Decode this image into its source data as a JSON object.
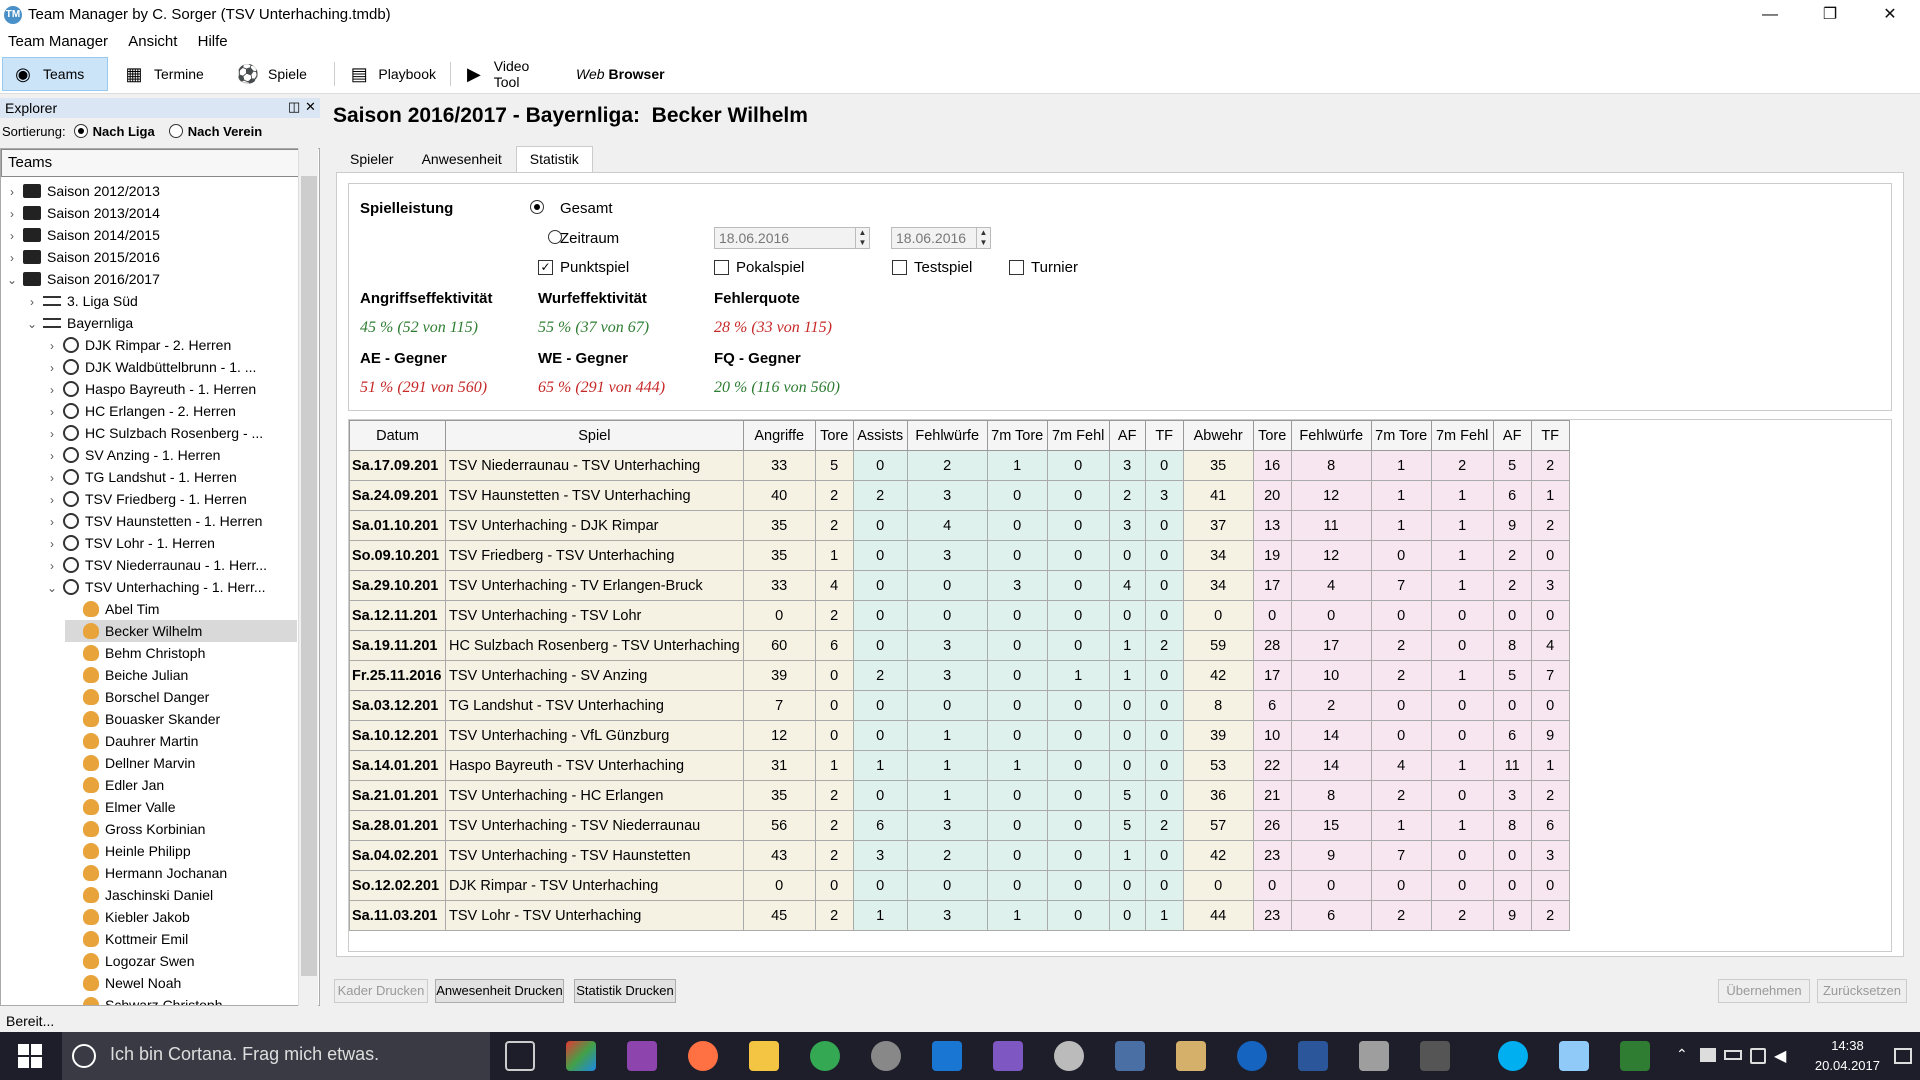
{
  "window": {
    "title": "Team Manager by C. Sorger (TSV Unterhaching.tmdb)"
  },
  "menu": [
    "Team Manager",
    "Ansicht",
    "Hilfe"
  ],
  "toolbar": {
    "teams": "Teams",
    "termine": "Termine",
    "spiele": "Spiele",
    "playbook": "Playbook",
    "video": "Video Tool",
    "web_prefix": "Web",
    "web": "Browser"
  },
  "explorer": {
    "title": "Explorer",
    "sort_label": "Sortierung:",
    "sort_liga": "Nach Liga",
    "sort_verein": "Nach Verein",
    "tree_header": "Teams",
    "items": [
      {
        "label": "Saison 2012/2013",
        "level": 0,
        "icon": "folder-icon",
        "chev": "›"
      },
      {
        "label": "Saison 2013/2014",
        "level": 0,
        "icon": "folder-icon",
        "chev": "›"
      },
      {
        "label": "Saison 2014/2015",
        "level": 0,
        "icon": "folder-icon",
        "chev": "›"
      },
      {
        "label": "Saison 2015/2016",
        "level": 0,
        "icon": "folder-icon",
        "chev": "›"
      },
      {
        "label": "Saison 2016/2017",
        "level": 0,
        "icon": "folder-icon",
        "chev": "⌄"
      },
      {
        "label": "3. Liga Süd",
        "level": 1,
        "icon": "list-icon",
        "chev": "›"
      },
      {
        "label": "Bayernliga",
        "level": 1,
        "icon": "list-icon",
        "chev": "⌄"
      },
      {
        "label": "DJK Rimpar - 2. Herren",
        "level": 2,
        "icon": "team-icon",
        "chev": "›"
      },
      {
        "label": "DJK Waldbüttelbrunn - 1. ...",
        "level": 2,
        "icon": "team-icon",
        "chev": "›"
      },
      {
        "label": "Haspo Bayreuth - 1. Herren",
        "level": 2,
        "icon": "team-icon",
        "chev": "›"
      },
      {
        "label": "HC Erlangen - 2. Herren",
        "level": 2,
        "icon": "team-icon",
        "chev": "›"
      },
      {
        "label": "HC Sulzbach Rosenberg - ...",
        "level": 2,
        "icon": "team-icon",
        "chev": "›"
      },
      {
        "label": "SV Anzing - 1. Herren",
        "level": 2,
        "icon": "team-icon",
        "chev": "›"
      },
      {
        "label": "TG Landshut - 1. Herren",
        "level": 2,
        "icon": "team-icon",
        "chev": "›"
      },
      {
        "label": "TSV Friedberg - 1. Herren",
        "level": 2,
        "icon": "team-icon",
        "chev": "›"
      },
      {
        "label": "TSV Haunstetten - 1. Herren",
        "level": 2,
        "icon": "team-icon",
        "chev": "›"
      },
      {
        "label": "TSV Lohr - 1. Herren",
        "level": 2,
        "icon": "team-icon",
        "chev": "›"
      },
      {
        "label": "TSV Niederraunau - 1. Herr...",
        "level": 2,
        "icon": "team-icon",
        "chev": "›"
      },
      {
        "label": "TSV Unterhaching - 1. Herr...",
        "level": 2,
        "icon": "team-icon",
        "chev": "⌄"
      },
      {
        "label": "Abel Tim",
        "level": 3,
        "icon": "player-icon",
        "chev": ""
      },
      {
        "label": "Becker Wilhelm",
        "level": 3,
        "icon": "player-icon",
        "chev": "",
        "selected": true
      },
      {
        "label": "Behm Christoph",
        "level": 3,
        "icon": "player-icon",
        "chev": ""
      },
      {
        "label": "Beiche Julian",
        "level": 3,
        "icon": "player-icon",
        "chev": ""
      },
      {
        "label": "Borschel Danger",
        "level": 3,
        "icon": "player-icon",
        "chev": ""
      },
      {
        "label": "Bouasker Skander",
        "level": 3,
        "icon": "player-icon",
        "chev": ""
      },
      {
        "label": "Dauhrer Martin",
        "level": 3,
        "icon": "player-icon",
        "chev": ""
      },
      {
        "label": "Dellner Marvin",
        "level": 3,
        "icon": "player-icon",
        "chev": ""
      },
      {
        "label": "Edler Jan",
        "level": 3,
        "icon": "player-icon",
        "chev": ""
      },
      {
        "label": "Elmer Valle",
        "level": 3,
        "icon": "player-icon",
        "chev": ""
      },
      {
        "label": "Gross Korbinian",
        "level": 3,
        "icon": "player-icon",
        "chev": ""
      },
      {
        "label": "Heinle Philipp",
        "level": 3,
        "icon": "player-icon",
        "chev": ""
      },
      {
        "label": "Hermann Jochanan",
        "level": 3,
        "icon": "player-icon",
        "chev": ""
      },
      {
        "label": "Jaschinski Daniel",
        "level": 3,
        "icon": "player-icon",
        "chev": ""
      },
      {
        "label": "Kiebler Jakob",
        "level": 3,
        "icon": "player-icon",
        "chev": ""
      },
      {
        "label": "Kottmeir Emil",
        "level": 3,
        "icon": "player-icon",
        "chev": ""
      },
      {
        "label": "Logozar Swen",
        "level": 3,
        "icon": "player-icon",
        "chev": ""
      },
      {
        "label": "Newel Noah",
        "level": 3,
        "icon": "player-icon",
        "chev": ""
      },
      {
        "label": "Schwarz Christoph",
        "level": 3,
        "icon": "player-icon",
        "chev": ""
      }
    ]
  },
  "page": {
    "season": "Saison 2016/2017 - Bayernliga:",
    "player": "Becker Wilhelm"
  },
  "tabs": [
    "Spieler",
    "Anwesenheit",
    "Statistik"
  ],
  "filter": {
    "section": "Spielleistung",
    "gesamt": "Gesamt",
    "zeitraum": "Zeitraum",
    "date_from": "18.06.2016",
    "date_to": "18.06.2016",
    "punktspiel": "Punktspiel",
    "pokalspiel": "Pokalspiel",
    "testspiel": "Testspiel",
    "turnier": "Turnier"
  },
  "summary": {
    "ae_label": "Angriffseffektivität",
    "ae_value": "45 %  (52 von 115)",
    "we_label": "Wurfeffektivität",
    "we_value": "55 %  (37 von 67)",
    "fq_label": "Fehlerquote",
    "fq_value": "28 %  (33 von 115)",
    "aeg_label": "AE - Gegner",
    "aeg_value": "51 %  (291 von 560)",
    "weg_label": "WE - Gegner",
    "weg_value": "65 %  (291 von 444)",
    "fqg_label": "FQ - Gegner",
    "fqg_value": "20 %  (116 von 560)"
  },
  "table": {
    "headers": [
      "Datum",
      "Spiel",
      "Angriffe",
      "Tore",
      "Assists",
      "Fehlwürfe",
      "7m Tore",
      "7m Fehl",
      "AF",
      "TF",
      "Abwehr",
      "Tore",
      "Fehlwürfe",
      "7m Tore",
      "7m Fehl",
      "AF",
      "TF"
    ],
    "rows": [
      [
        "Sa.17.09.201",
        "TSV Niederraunau  -  TSV Unterhaching",
        "33",
        "5",
        "0",
        "2",
        "1",
        "0",
        "3",
        "0",
        "35",
        "16",
        "8",
        "1",
        "2",
        "5",
        "2"
      ],
      [
        "Sa.24.09.201",
        "TSV Haunstetten  -  TSV Unterhaching",
        "40",
        "2",
        "2",
        "3",
        "0",
        "0",
        "2",
        "3",
        "41",
        "20",
        "12",
        "1",
        "1",
        "6",
        "1"
      ],
      [
        "Sa.01.10.201",
        "TSV Unterhaching  -  DJK Rimpar",
        "35",
        "2",
        "0",
        "4",
        "0",
        "0",
        "3",
        "0",
        "37",
        "13",
        "11",
        "1",
        "1",
        "9",
        "2"
      ],
      [
        "So.09.10.201",
        "TSV Friedberg  -  TSV Unterhaching",
        "35",
        "1",
        "0",
        "3",
        "0",
        "0",
        "0",
        "0",
        "34",
        "19",
        "12",
        "0",
        "1",
        "2",
        "0"
      ],
      [
        "Sa.29.10.201",
        "TSV Unterhaching  -  TV Erlangen-Bruck",
        "33",
        "4",
        "0",
        "0",
        "3",
        "0",
        "4",
        "0",
        "34",
        "17",
        "4",
        "7",
        "1",
        "2",
        "3"
      ],
      [
        "Sa.12.11.201",
        "TSV Unterhaching  -  TSV Lohr",
        "0",
        "2",
        "0",
        "0",
        "0",
        "0",
        "0",
        "0",
        "0",
        "0",
        "0",
        "0",
        "0",
        "0",
        "0"
      ],
      [
        "Sa.19.11.201",
        "HC Sulzbach Rosenberg  -  TSV Unterhaching",
        "60",
        "6",
        "0",
        "3",
        "0",
        "0",
        "1",
        "2",
        "59",
        "28",
        "17",
        "2",
        "0",
        "8",
        "4"
      ],
      [
        "Fr.25.11.2016",
        "TSV Unterhaching  -  SV Anzing",
        "39",
        "0",
        "2",
        "3",
        "0",
        "1",
        "1",
        "0",
        "42",
        "17",
        "10",
        "2",
        "1",
        "5",
        "7"
      ],
      [
        "Sa.03.12.201",
        "TG Landshut  -  TSV Unterhaching",
        "7",
        "0",
        "0",
        "0",
        "0",
        "0",
        "0",
        "0",
        "8",
        "6",
        "2",
        "0",
        "0",
        "0",
        "0"
      ],
      [
        "Sa.10.12.201",
        "TSV Unterhaching  -  VfL Günzburg",
        "12",
        "0",
        "0",
        "1",
        "0",
        "0",
        "0",
        "0",
        "39",
        "10",
        "14",
        "0",
        "0",
        "6",
        "9"
      ],
      [
        "Sa.14.01.201",
        "Haspo Bayreuth  -  TSV Unterhaching",
        "31",
        "1",
        "1",
        "1",
        "1",
        "0",
        "0",
        "0",
        "53",
        "22",
        "14",
        "4",
        "1",
        "11",
        "1"
      ],
      [
        "Sa.21.01.201",
        "TSV Unterhaching  -  HC Erlangen",
        "35",
        "2",
        "0",
        "1",
        "0",
        "0",
        "5",
        "0",
        "36",
        "21",
        "8",
        "2",
        "0",
        "3",
        "2"
      ],
      [
        "Sa.28.01.201",
        "TSV Unterhaching  -  TSV Niederraunau",
        "56",
        "2",
        "6",
        "3",
        "0",
        "0",
        "5",
        "2",
        "57",
        "26",
        "15",
        "1",
        "1",
        "8",
        "6"
      ],
      [
        "Sa.04.02.201",
        "TSV Unterhaching  -  TSV Haunstetten",
        "43",
        "2",
        "3",
        "2",
        "0",
        "0",
        "1",
        "0",
        "42",
        "23",
        "9",
        "7",
        "0",
        "0",
        "3"
      ],
      [
        "So.12.02.201",
        "DJK Rimpar  -  TSV Unterhaching",
        "0",
        "0",
        "0",
        "0",
        "0",
        "0",
        "0",
        "0",
        "0",
        "0",
        "0",
        "0",
        "0",
        "0",
        "0"
      ],
      [
        "Sa.11.03.201",
        "TSV Lohr  -  TSV Unterhaching",
        "45",
        "2",
        "1",
        "3",
        "1",
        "0",
        "0",
        "1",
        "44",
        "23",
        "6",
        "2",
        "2",
        "9",
        "2"
      ]
    ]
  },
  "buttons": {
    "kader": "Kader Drucken",
    "anwesenheit": "Anwesenheit Drucken",
    "statistik": "Statistik Drucken",
    "uebernehmen": "Übernehmen",
    "zuruecksetzen": "Zurücksetzen"
  },
  "status": "Bereit...",
  "taskbar": {
    "cortana": "Ich bin Cortana. Frag mich etwas.",
    "time": "14:38",
    "date": "20.04.2017"
  }
}
